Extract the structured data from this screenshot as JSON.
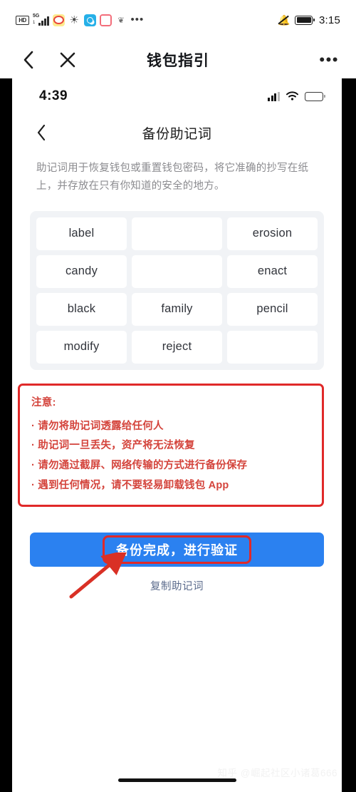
{
  "outer_status_bar": {
    "hd_badge": "HD",
    "network_label": "5G",
    "network_sub": "1",
    "icons": [
      {
        "name": "weibo-icon",
        "glyph": ""
      },
      {
        "name": "browser-globe-icon",
        "glyph": "⊕"
      },
      {
        "name": "search-app-icon",
        "glyph": ""
      },
      {
        "name": "pink-app-icon",
        "glyph": ""
      },
      {
        "name": "gray-app-icon",
        "glyph": "❦"
      }
    ],
    "overflow_dots": "•••",
    "time": "3:15"
  },
  "outer_header": {
    "back_icon": "chevron-left-icon",
    "close_icon": "close-icon",
    "title": "钱包指引",
    "more_dots": "•••"
  },
  "inner_status_bar": {
    "time": "4:39",
    "signal_icon": "cellular-signal-icon",
    "wifi_glyph": "📶",
    "battery_icon": "battery-low-power-icon"
  },
  "inner_header": {
    "back_icon": "chevron-left-icon",
    "title": "备份助记词"
  },
  "description": "助记词用于恢复钱包或重置钱包密码，将它准确的抄写在纸上，并存放在只有你知道的安全的地方。",
  "mnemonic": {
    "words": [
      "label",
      "",
      "erosion",
      "candy",
      "",
      "enact",
      "black",
      "family",
      "pencil",
      "modify",
      "reject",
      ""
    ]
  },
  "warning": {
    "title": "注意:",
    "items": [
      "· 请勿将助记词透露给任何人",
      "· 助记词一旦丢失，资产将无法恢复",
      "· 请勿通过截屏、网络传输的方式进行备份保存",
      "· 遇到任何情况，请不要轻易卸载钱包 App"
    ],
    "border_color": "#e02929",
    "text_color": "#d4443c"
  },
  "actions": {
    "primary_button_label": "备份完成，进行验证",
    "primary_button_color": "#2b81f0",
    "highlight_color": "#e02929",
    "copy_link_label": "复制助记词",
    "copy_link_color": "#5b6b8c",
    "annotation_arrow": "red-arrow-annotation"
  },
  "watermark": "知乎 @崛起社区小诸葛666"
}
